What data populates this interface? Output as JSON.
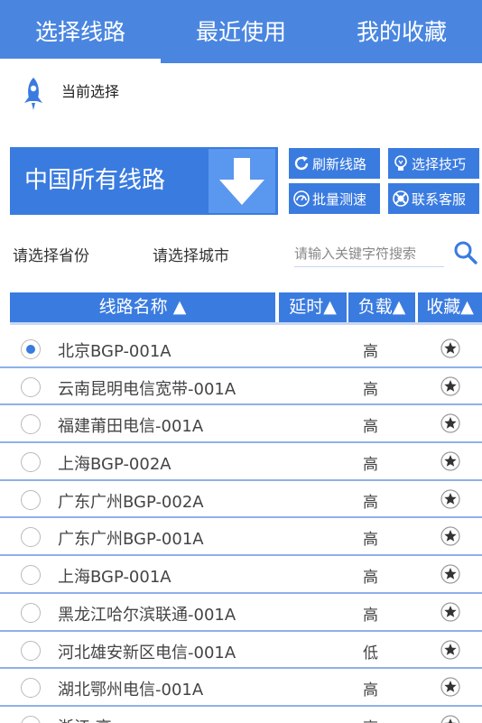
{
  "tabs": [
    {
      "label": "选择线路",
      "active": true
    },
    {
      "label": "最近使用",
      "active": false
    },
    {
      "label": "我的收藏",
      "active": false
    }
  ],
  "current": {
    "label": "当前选择",
    "icon": "rocket-icon"
  },
  "main_route": {
    "label": "中国所有线路",
    "icon": "arrow-down-icon"
  },
  "actions": {
    "refresh": "刷新线路",
    "tips": "选择技巧",
    "batch": "批量测速",
    "contact": "联系客服"
  },
  "filters": {
    "province": "请选择省份",
    "city": "请选择城市",
    "search_placeholder": "请输入关键字符搜索"
  },
  "table": {
    "headers": {
      "name": "线路名称 ▲",
      "latency": "延时▲",
      "load": "负载▲",
      "favorite": "收藏▲"
    },
    "rows": [
      {
        "name": "北京BGP-001A",
        "load": "高",
        "selected": true
      },
      {
        "name": "云南昆明电信宽带-001A",
        "load": "高",
        "selected": false
      },
      {
        "name": "福建莆田电信-001A",
        "load": "高",
        "selected": false
      },
      {
        "name": "上海BGP-002A",
        "load": "高",
        "selected": false
      },
      {
        "name": "广东广州BGP-002A",
        "load": "高",
        "selected": false
      },
      {
        "name": "广东广州BGP-001A",
        "load": "高",
        "selected": false
      },
      {
        "name": "上海BGP-001A",
        "load": "高",
        "selected": false
      },
      {
        "name": "黑龙江哈尔滨联通-001A",
        "load": "高",
        "selected": false
      },
      {
        "name": "河北雄安新区电信-001A",
        "load": "低",
        "selected": false
      },
      {
        "name": "湖北鄂州电信-001A",
        "load": "高",
        "selected": false
      },
      {
        "name": "浙江 高",
        "load": "高",
        "selected": false
      }
    ]
  },
  "colors": {
    "primary": "#3a7be0",
    "tab_bar": "#4a86e0",
    "row_divider": "#8fb0ea"
  }
}
